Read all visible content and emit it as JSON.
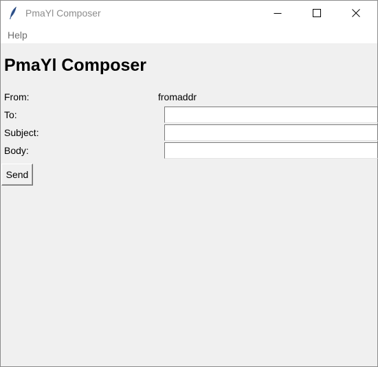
{
  "window": {
    "title": "PmaYl Composer"
  },
  "menu": {
    "items": [
      "Help"
    ]
  },
  "main": {
    "heading": "PmaYl Composer",
    "from_label": "From:",
    "from_value": "fromaddr",
    "to_label": "To:",
    "to_value": "",
    "subject_label": "Subject:",
    "subject_value": "",
    "body_label": "Body:",
    "body_value": "",
    "send_label": "Send"
  },
  "icons": {
    "app": "feather-icon",
    "minimize": "minimize-icon",
    "maximize": "maximize-icon",
    "close": "close-icon"
  },
  "colors": {
    "background": "#f0f0f0",
    "titlebar": "#ffffff",
    "title_text": "#8c8c8c",
    "feather": "#3a5f9c"
  }
}
